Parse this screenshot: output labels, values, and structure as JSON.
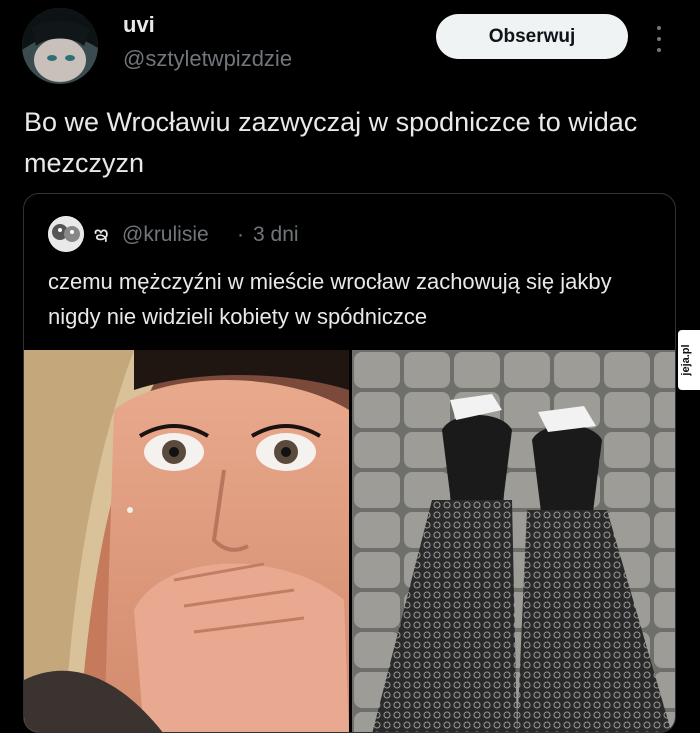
{
  "author": {
    "name": "uvi",
    "handle": "@sztyletwpizdzie"
  },
  "follow_button": {
    "label": "Obserwuj"
  },
  "tweet": {
    "text": "Bo we Wrocławiu zazwyczaj w spodniczce to widac mezczyzn"
  },
  "quoted_tweet": {
    "emoji": "ఇ",
    "handle": "@krulisie",
    "separator": "·",
    "time": "3 dni",
    "text": "czemu mężczyźni w mieście wrocław zachowują się jakby nigdy nie widzieli kobiety w spódniczce"
  },
  "watermark": {
    "text": "jeja.pl"
  },
  "colors": {
    "background": "#000000",
    "text_primary": "#e7e9ea",
    "text_secondary": "#71767b",
    "border": "#2f3336",
    "button_bg": "#eff3f4",
    "button_text": "#0f1419"
  },
  "icons": {
    "more": "more-vertical-icon"
  }
}
